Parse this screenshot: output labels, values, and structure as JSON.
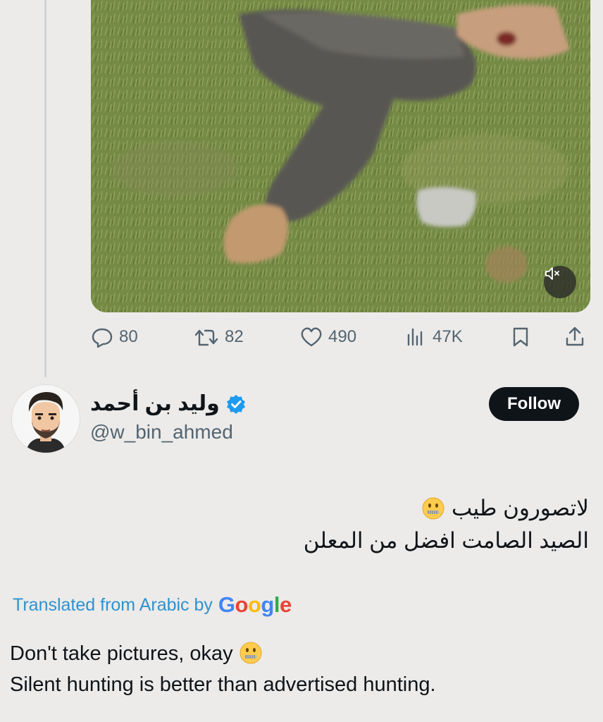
{
  "media": {
    "mute_icon": "muted-speaker-icon"
  },
  "actions": {
    "replies": "80",
    "reposts": "82",
    "likes": "490",
    "views": "47K",
    "icons": [
      "reply-icon",
      "repost-icon",
      "like-icon",
      "views-icon",
      "bookmark-icon",
      "share-icon"
    ]
  },
  "author": {
    "display_name": "وليد بن أحمد",
    "handle": "@w_bin_ahmed",
    "verified_color": "#1d9bf0",
    "follow_label": "Follow"
  },
  "tweet": {
    "arabic_line1": "لاتصورون طيب",
    "arabic_line2": "الصيد الصامت افضل من المعلن",
    "translated_label": "Translated from Arabic by",
    "translator_brand": "Google",
    "english_line1": "Don't take pictures, okay",
    "english_line2": "Silent hunting is better than advertised hunting."
  },
  "colors": {
    "accent": "#1d9bf0",
    "muted": "#536471",
    "link": "#2f92d0"
  }
}
